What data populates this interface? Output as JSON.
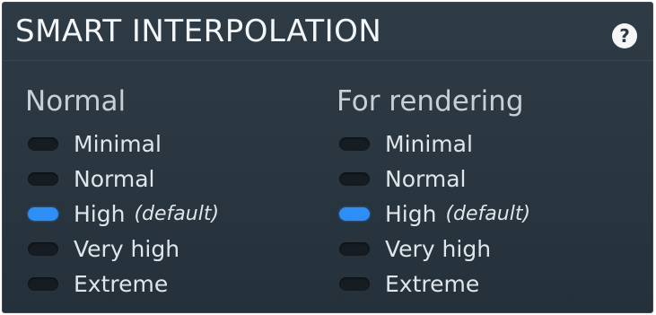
{
  "panel": {
    "title": "SMART INTERPOLATION",
    "help_icon": "question-mark-icon",
    "help_glyph": "?"
  },
  "colors": {
    "selected": "#2d8ef5",
    "unselected": "#151c22",
    "background": "#2a3640"
  },
  "columns": [
    {
      "title": "Normal",
      "options": [
        {
          "label": "Minimal",
          "suffix": "",
          "selected": false
        },
        {
          "label": "Normal",
          "suffix": "",
          "selected": false
        },
        {
          "label": "High",
          "suffix": "(default)",
          "selected": true
        },
        {
          "label": "Very high",
          "suffix": "",
          "selected": false
        },
        {
          "label": "Extreme",
          "suffix": "",
          "selected": false
        }
      ]
    },
    {
      "title": "For rendering",
      "options": [
        {
          "label": "Minimal",
          "suffix": "",
          "selected": false
        },
        {
          "label": "Normal",
          "suffix": "",
          "selected": false
        },
        {
          "label": "High",
          "suffix": "(default)",
          "selected": true
        },
        {
          "label": "Very high",
          "suffix": "",
          "selected": false
        },
        {
          "label": "Extreme",
          "suffix": "",
          "selected": false
        }
      ]
    }
  ]
}
